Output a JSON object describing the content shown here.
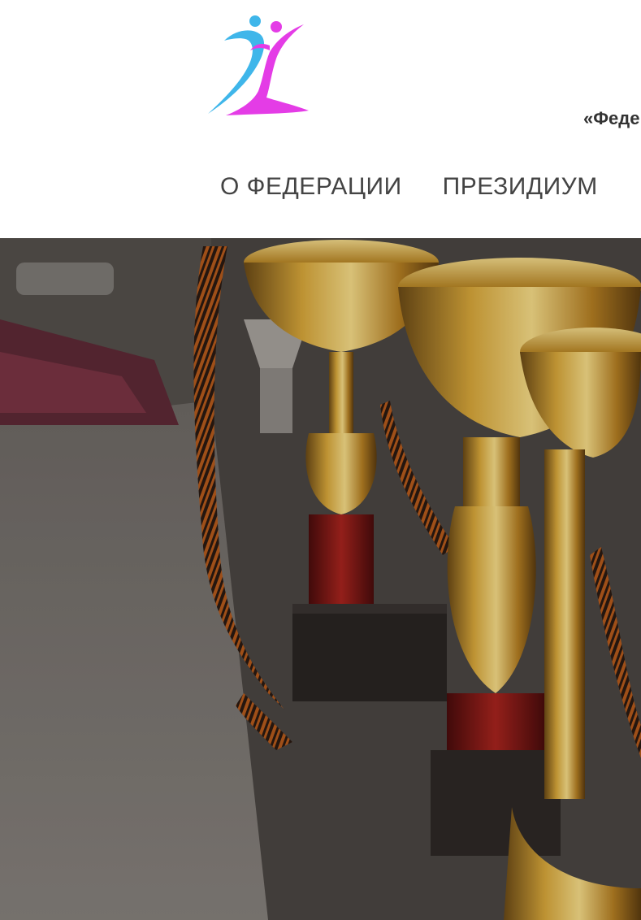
{
  "header": {
    "tagline": "«Феде"
  },
  "nav": {
    "items": [
      {
        "label": "О ФЕДЕРАЦИИ"
      },
      {
        "label": "ПРЕЗИДИУМ"
      }
    ]
  },
  "colors": {
    "logo_blue": "#3fb6ea",
    "logo_magenta": "#e43ce6",
    "nav_text": "#444444",
    "tagline_text": "#333333"
  }
}
